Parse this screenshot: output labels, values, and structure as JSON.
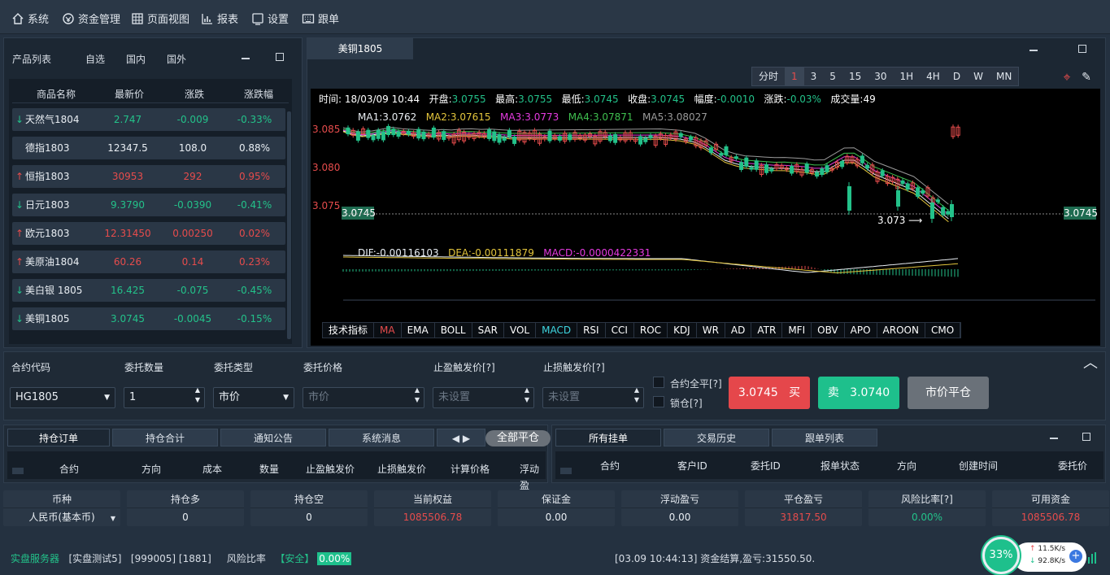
{
  "menu": [
    {
      "label": "系统",
      "icon": "home-icon"
    },
    {
      "label": "资金管理",
      "icon": "money-icon"
    },
    {
      "label": "页面视图",
      "icon": "grid-icon"
    },
    {
      "label": "报表",
      "icon": "chart-icon"
    },
    {
      "label": "设置",
      "icon": "settings-icon"
    },
    {
      "label": "跟单",
      "icon": "keyboard-icon"
    }
  ],
  "product_panel": {
    "tabs": [
      "产品列表",
      "自选",
      "国内",
      "国外"
    ],
    "headers": [
      "商品名称",
      "最新价",
      "涨跌",
      "涨跌幅"
    ],
    "rows": [
      {
        "name": "天然气1804",
        "price": "2.747",
        "change": "-0.009",
        "pct": "-0.33%",
        "dir": "down"
      },
      {
        "name": "德指1803",
        "price": "12347.5",
        "change": "108.0",
        "pct": "0.88%",
        "dir": "none"
      },
      {
        "name": "恒指1803",
        "price": "30953",
        "change": "292",
        "pct": "0.95%",
        "dir": "up"
      },
      {
        "name": "日元1803",
        "price": "9.3790",
        "change": "-0.0390",
        "pct": "-0.41%",
        "dir": "down"
      },
      {
        "name": "欧元1803",
        "price": "12.31450",
        "change": "0.00250",
        "pct": "0.02%",
        "dir": "up"
      },
      {
        "name": "美原油1804",
        "price": "60.26",
        "change": "0.14",
        "pct": "0.23%",
        "dir": "up"
      },
      {
        "name": "美白银 1805",
        "price": "16.425",
        "change": "-0.075",
        "pct": "-0.45%",
        "dir": "down"
      },
      {
        "name": "美铜1805",
        "price": "3.0745",
        "change": "-0.0045",
        "pct": "-0.15%",
        "dir": "down"
      }
    ]
  },
  "chart": {
    "tab": "美铜1805",
    "timeframes": [
      "分时",
      "1",
      "3",
      "5",
      "15",
      "30",
      "1H",
      "4H",
      "D",
      "W",
      "MN"
    ],
    "active_timeframe": "1",
    "info": {
      "time_label": "时间:",
      "time": "18/03/09 10:44",
      "open_label": "开盘:",
      "open": "3.0755",
      "high_label": "最高:",
      "high": "3.0755",
      "low_label": "最低:",
      "low": "3.0745",
      "close_label": "收盘:",
      "close": "3.0745",
      "amp_label": "幅度:",
      "amp": "-0.0010",
      "chg_label": "涨跌:",
      "chg": "-0.03%",
      "vol_label": "成交量:",
      "vol": "49"
    },
    "ma": [
      "MA1:3.0762",
      "MA2:3.07615",
      "MA3:3.0773",
      "MA4:3.07871",
      "MA5:3.08027"
    ],
    "y_ticks": [
      "3.085",
      "3.080",
      "3.075"
    ],
    "last_price": "3.0745",
    "low_marker": "3.073",
    "macd": [
      "DIF:-0.00116103",
      "DEA:-0.00111879",
      "MACD:-0.0000422331"
    ],
    "indicators": [
      "技术指标",
      "MA",
      "EMA",
      "BOLL",
      "SAR",
      "VOL",
      "MACD",
      "RSI",
      "CCI",
      "ROC",
      "KDJ",
      "WR",
      "AD",
      "ATR",
      "MFI",
      "OBV",
      "APO",
      "AROON",
      "CMO"
    ]
  },
  "order": {
    "labels": [
      "合约代码",
      "委托数量",
      "委托类型",
      "委托价格",
      "止盈触发价[?]",
      "止损触发价[?]"
    ],
    "code": "HG1805",
    "qty": "1",
    "type": "市价",
    "price_ph": "市价",
    "tp_ph": "未设置",
    "sl_ph": "未设置",
    "check1": "合约全平[?]",
    "check2": "锁仓[?]",
    "buy_price": "3.0745",
    "buy_label": "买",
    "sell_label": "卖",
    "sell_price": "3.0740",
    "close_label": "市价平仓"
  },
  "positions": {
    "tabs": [
      "持仓订单",
      "持仓合计",
      "通知公告",
      "系统消息"
    ],
    "close_all": "全部平仓",
    "headers": [
      "合约",
      "方向",
      "成本",
      "数量",
      "止盈触发价",
      "止损触发价",
      "计算价格",
      "浮动盈"
    ]
  },
  "orders_panel": {
    "tabs": [
      "所有挂单",
      "交易历史",
      "跟单列表"
    ],
    "headers": [
      "合约",
      "客户ID",
      "委托ID",
      "报单状态",
      "方向",
      "创建时间",
      "委托价"
    ]
  },
  "stats": [
    {
      "title": "币种",
      "value": "人民币(基本币)",
      "color": "white"
    },
    {
      "title": "持仓多",
      "value": "0",
      "color": "white"
    },
    {
      "title": "持仓空",
      "value": "0",
      "color": "white"
    },
    {
      "title": "当前权益",
      "value": "1085506.78",
      "color": "red"
    },
    {
      "title": "保证金",
      "value": "0.00",
      "color": "white"
    },
    {
      "title": "浮动盈亏",
      "value": "0.00",
      "color": "white"
    },
    {
      "title": "平仓盈亏",
      "value": "31817.50",
      "color": "red"
    },
    {
      "title": "风险比率[?]",
      "value": "0.00%",
      "color": "green"
    },
    {
      "title": "可用资金",
      "value": "1085506.78",
      "color": "red"
    }
  ],
  "status": {
    "server": "实盘服务器",
    "account": "[实盘测试5]",
    "ids": "[999005] [1881]",
    "risk_label": "风险比率",
    "safe": "【安全】",
    "risk": "0.00%",
    "message": "[03.09 10:44:13] 资金结算,盈亏:31550.50.",
    "gauge": "33%",
    "up_speed": "11.5K/s",
    "down_speed": "92.8K/s"
  },
  "colors": {
    "up": "#e64c4c",
    "down": "#23c28a",
    "bg": "#243140"
  }
}
